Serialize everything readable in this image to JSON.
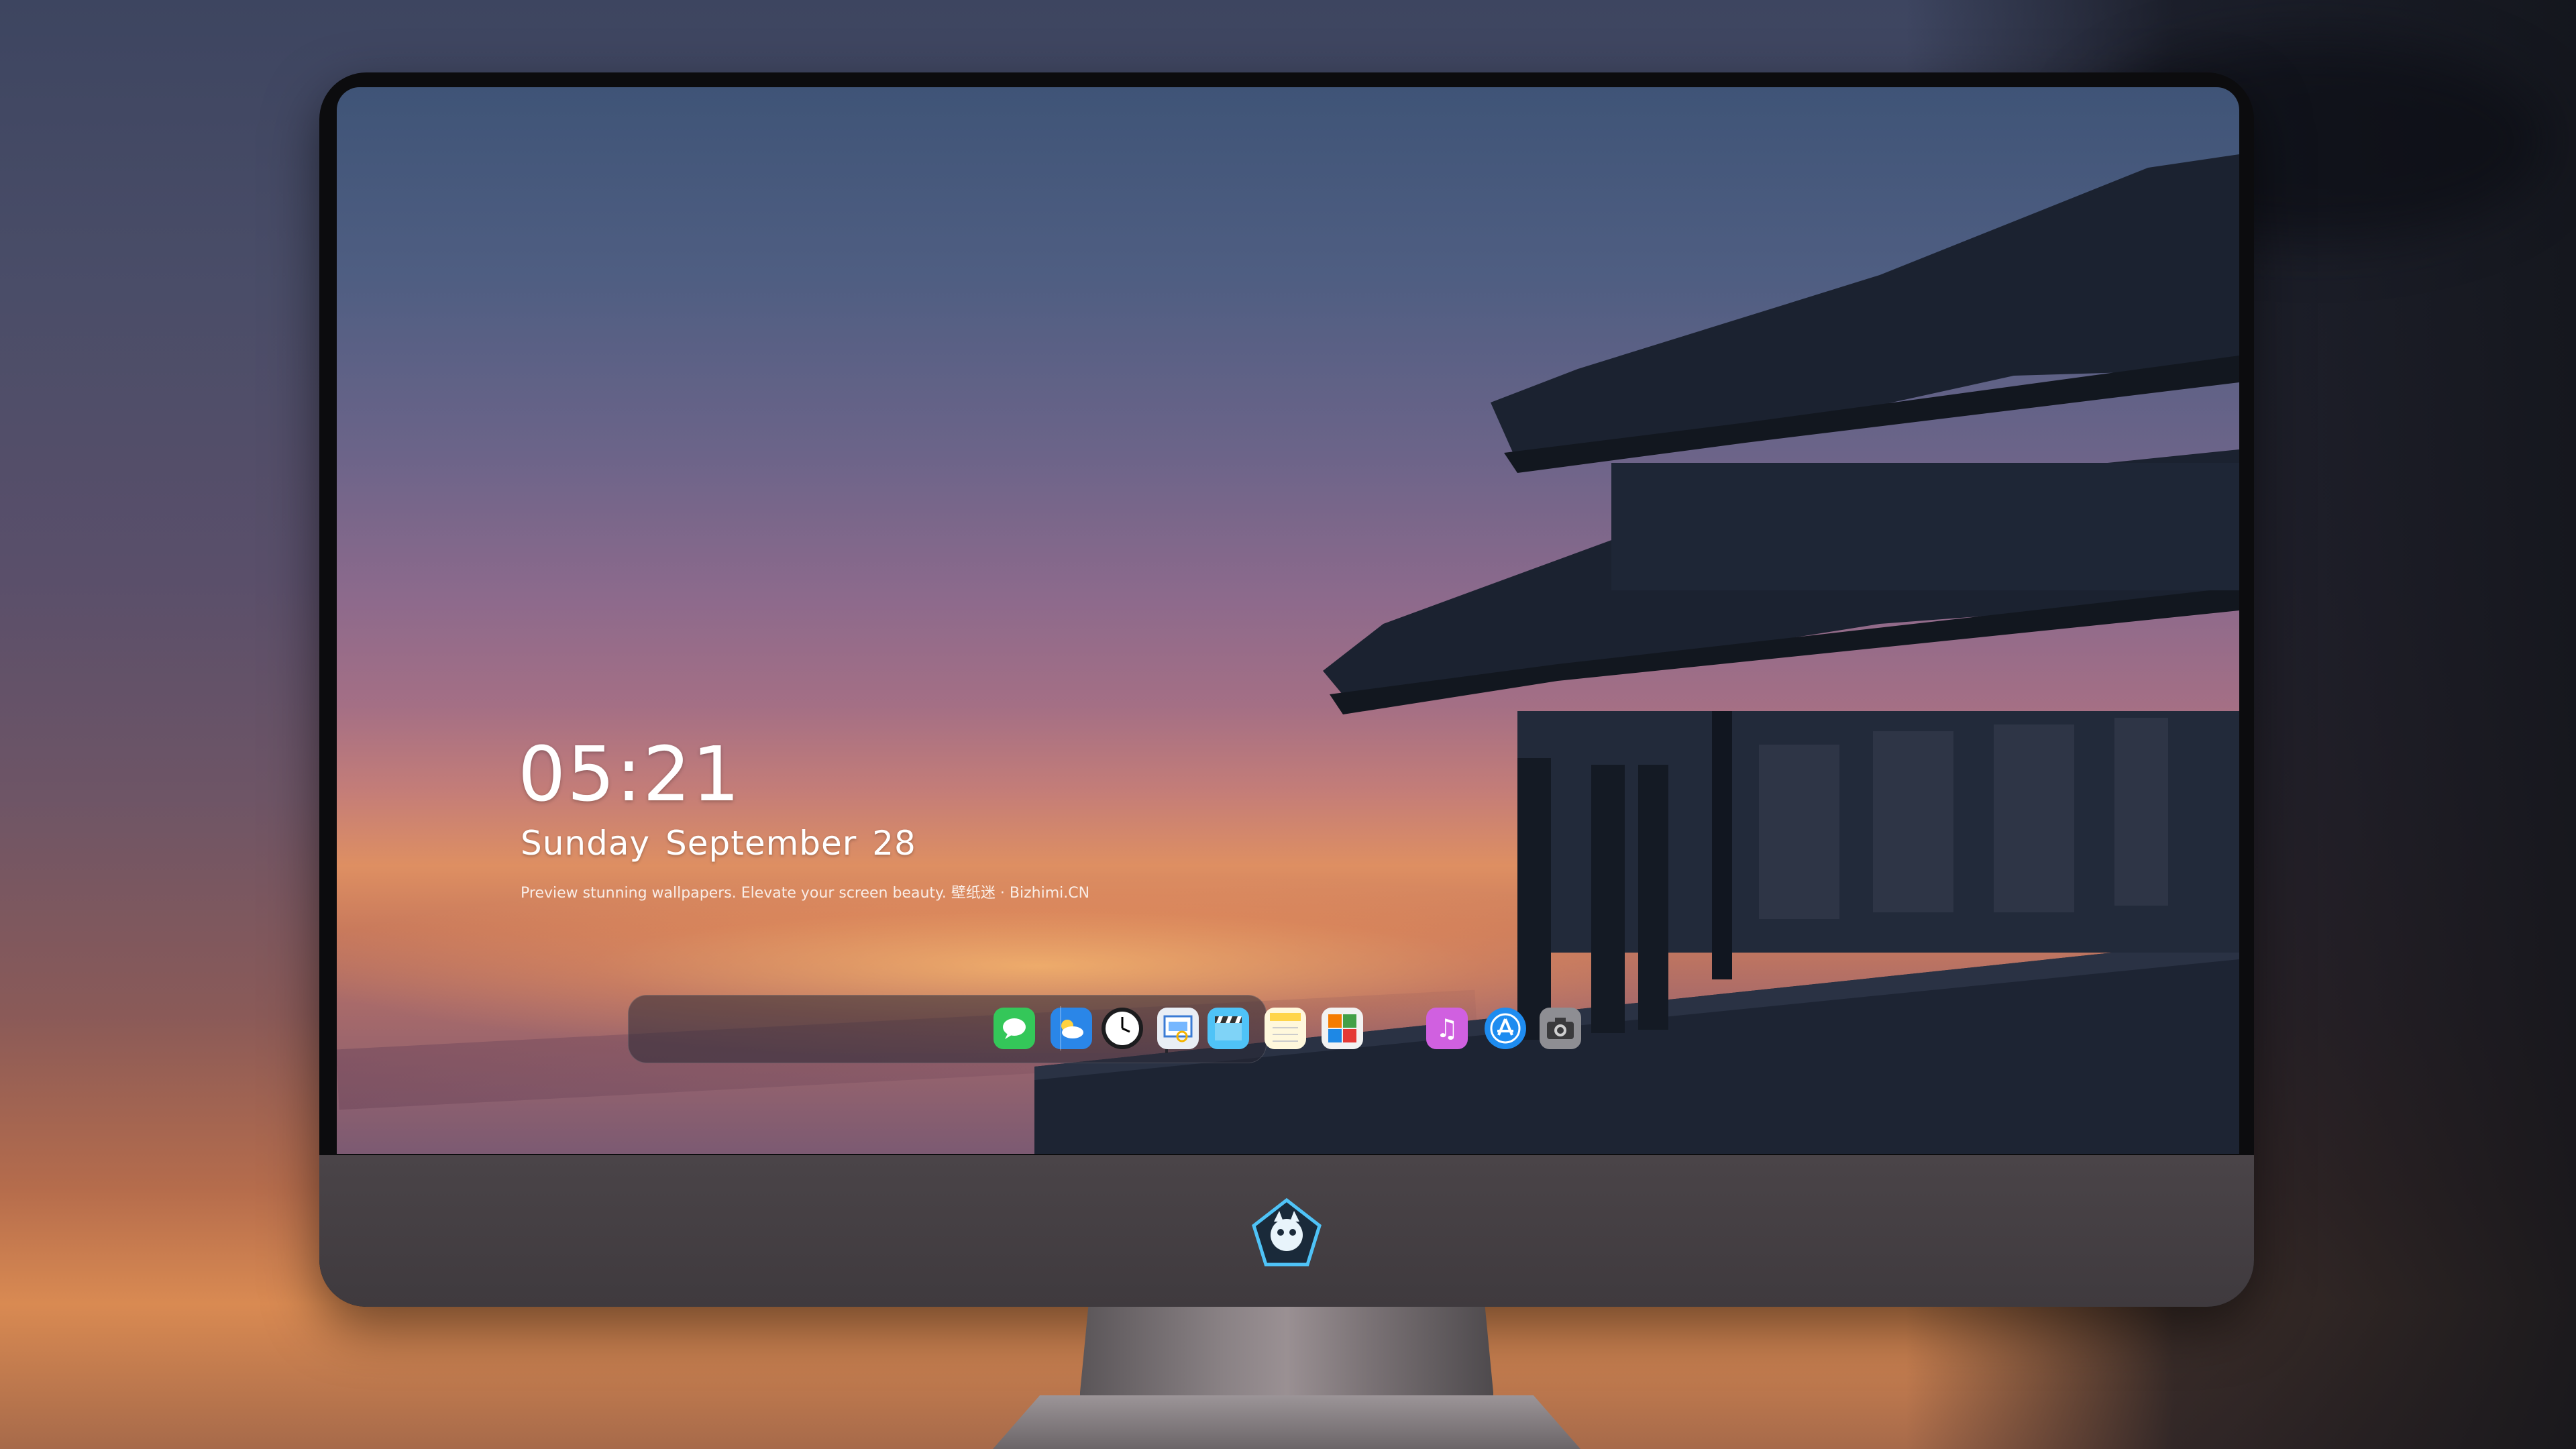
{
  "lock_screen": {
    "time": "05:21",
    "date": "Sunday September  28",
    "caption": "Preview stunning wallpapers. Elevate your screen beauty. 壁纸迷 · Bizhimi.CN"
  },
  "dock": {
    "apps": [
      {
        "name": "Messages",
        "icon": "messages-icon",
        "color": "#34c759"
      },
      {
        "name": "Weather",
        "icon": "weather-icon",
        "color": "#2a86e8"
      },
      {
        "name": "Clock",
        "icon": "clock-icon",
        "color": "#1c1c1e"
      },
      {
        "name": "Preview",
        "icon": "preview-icon",
        "color": "#e9eef5"
      },
      {
        "name": "Clips",
        "icon": "clapperboard-icon",
        "color": "#4fc3f7"
      },
      {
        "name": "Notes",
        "icon": "notes-icon",
        "color": "#fff8dc"
      },
      {
        "name": "Photo Booth",
        "icon": "photobooth-icon",
        "color": "#f2f2f2"
      },
      {
        "name": "iTunes",
        "icon": "music-icon",
        "color": "#d060e0"
      },
      {
        "name": "App Store",
        "icon": "appstore-icon",
        "color": "#1e8cf0"
      },
      {
        "name": "Screenshot",
        "icon": "camera-icon",
        "color": "#8e8e93"
      }
    ]
  }
}
